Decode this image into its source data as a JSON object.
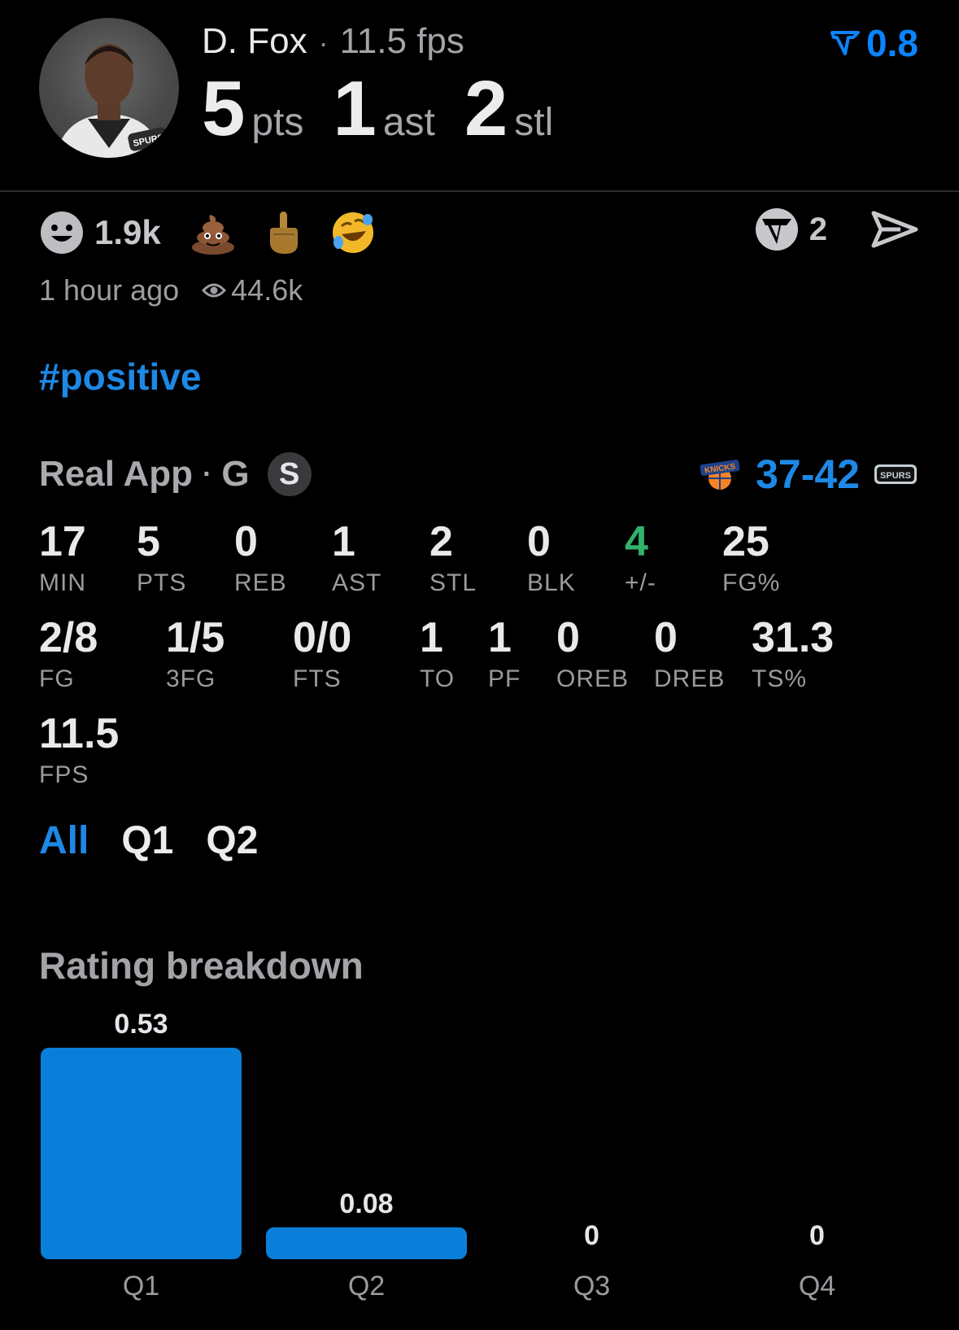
{
  "player": {
    "name": "D. Fox",
    "fps_label": "11.5 fps",
    "headline": [
      {
        "value": "5",
        "unit": "pts"
      },
      {
        "value": "1",
        "unit": "ast"
      },
      {
        "value": "2",
        "unit": "stl"
      }
    ],
    "rating": "0.8",
    "jersey_team": "SPURS"
  },
  "reactions": {
    "count": "1.9k",
    "emojis": [
      "smiley-icon",
      "poop-emoji-icon",
      "middle-finger-emoji-icon",
      "rolling-laughing-emoji-icon"
    ],
    "shares": "2"
  },
  "meta": {
    "time": "1 hour ago",
    "views": "44.6k"
  },
  "hashtag": "#positive",
  "game": {
    "source": "Real App",
    "position": "G",
    "badge": "S",
    "score": "37-42",
    "home_logo": "knicks-logo",
    "away_logo": "spurs-logo",
    "home_logo_text": "KNICKS",
    "away_logo_text": "SPURS"
  },
  "stats": {
    "row1": [
      {
        "value": "17",
        "label": "MIN"
      },
      {
        "value": "5",
        "label": "PTS"
      },
      {
        "value": "0",
        "label": "REB"
      },
      {
        "value": "1",
        "label": "AST"
      },
      {
        "value": "2",
        "label": "STL"
      },
      {
        "value": "0",
        "label": "BLK"
      },
      {
        "value": "4",
        "label": "+/-"
      },
      {
        "value": "25",
        "label": "FG%"
      }
    ],
    "row2": [
      {
        "value": "2/8",
        "label": "FG"
      },
      {
        "value": "1/5",
        "label": "3FG"
      },
      {
        "value": "0/0",
        "label": "FTS"
      },
      {
        "value": "1",
        "label": "TO"
      },
      {
        "value": "1",
        "label": "PF"
      },
      {
        "value": "0",
        "label": "OREB"
      },
      {
        "value": "0",
        "label": "DREB"
      },
      {
        "value": "31.3",
        "label": "TS%"
      }
    ],
    "row3": [
      {
        "value": "11.5",
        "label": "FPS"
      }
    ]
  },
  "tabs": [
    {
      "label": "All",
      "active": true
    },
    {
      "label": "Q1",
      "active": false
    },
    {
      "label": "Q2",
      "active": false
    }
  ],
  "breakdown_title": "Rating breakdown",
  "chart_data": {
    "type": "bar",
    "title": "Rating breakdown",
    "categories": [
      "Q1",
      "Q2",
      "Q3",
      "Q4"
    ],
    "values": [
      0.53,
      0.08,
      0,
      0
    ],
    "value_labels": [
      "0.53",
      "0.08",
      "0",
      "0"
    ],
    "color": "#0a7fd9"
  }
}
